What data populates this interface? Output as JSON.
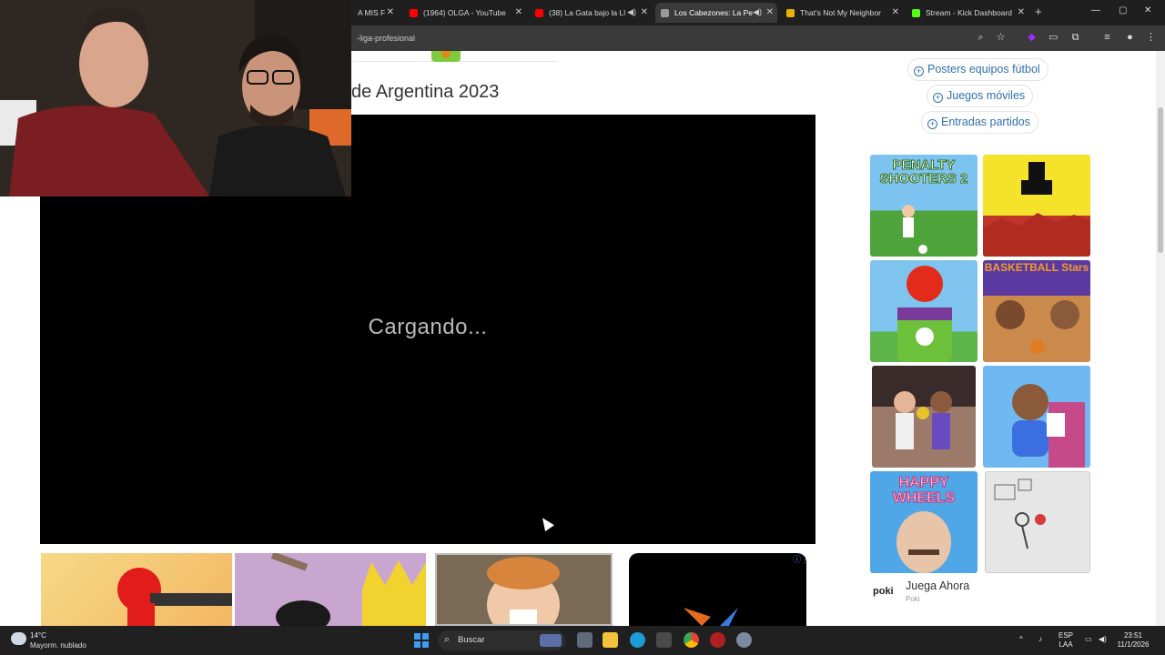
{
  "browser": {
    "tabs": [
      {
        "label": "A MIS F",
        "favicon": "#cc3333"
      },
      {
        "label": "(1964) OLGA - YouTube",
        "favicon": "#ff0000"
      },
      {
        "label": "(38) La Gata bajo la Ll",
        "favicon": "#ff0000"
      },
      {
        "label": "Los Cabezones: La Pe",
        "favicon": "#888888"
      },
      {
        "label": "That's Not My Neighbor",
        "favicon": "#e6b400"
      },
      {
        "label": "Stream - Kick Dashboard",
        "favicon": "#53fc18"
      }
    ],
    "url": "-liga-profesional"
  },
  "page": {
    "title": "de Argentina 2023",
    "loading_text": "Cargando...",
    "right_links": [
      {
        "label": "Posters equipos fútbol"
      },
      {
        "label": "Juegos móviles"
      },
      {
        "label": "Entradas partidos"
      }
    ],
    "ad_tiles": [
      {
        "title": "PENALTY SHOOTERS 2",
        "colors": [
          "#7cc3f0",
          "#4ea33a"
        ]
      },
      {
        "title": "",
        "colors": [
          "#f5e32b",
          "#c0352b"
        ]
      },
      {
        "title": "",
        "colors": [
          "#7fc4ee",
          "#5db54a"
        ]
      },
      {
        "title": "BASKETBALL Stars",
        "colors": [
          "#5a3aa0",
          "#c98a4b"
        ]
      },
      {
        "title": "",
        "colors": [
          "#3a2b2b",
          "#9b7a6a"
        ]
      },
      {
        "title": "",
        "colors": [
          "#6fb8f2",
          "#c64a8a"
        ]
      },
      {
        "title": "HAPPY WHEELS",
        "colors": [
          "#4fa7e8",
          "#e8c4a8"
        ]
      },
      {
        "title": "",
        "colors": [
          "#e6e6e6",
          "#cfcfcf"
        ]
      }
    ],
    "poki": {
      "logo": "poki",
      "cta": "Juega Ahora",
      "sub": "Poki"
    }
  },
  "taskbar": {
    "weather_temp": "14°C",
    "weather_desc": "Mayorm. nublado",
    "search_label": "Buscar",
    "lang_top": "ESP",
    "lang_bottom": "LAA",
    "time": "23:51",
    "date": "11/1/2026"
  }
}
